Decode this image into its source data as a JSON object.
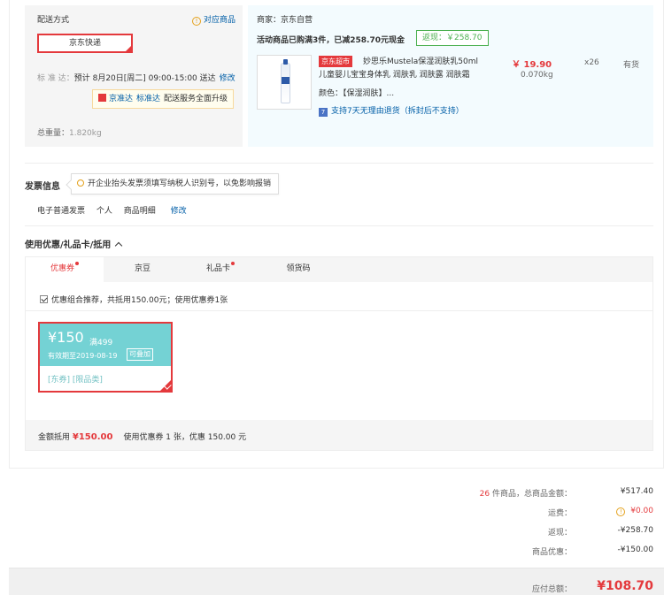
{
  "shipping": {
    "title": "配送方式",
    "link": "对应商品",
    "option": "京东快递",
    "time_label": "标 准 达：",
    "time_value": "预计 8月20日[周二] 09:00-15:00 送达",
    "edit": "修改",
    "tip_items": [
      "京准达",
      "标准达"
    ],
    "tip_text": "配送服务全面升级",
    "weight_label": "总重量：",
    "weight_value": "1.820kg"
  },
  "merchant": {
    "name": "商家：京东自营",
    "promo": "活动商品已购满3件，已减258.70元现金",
    "rebate": "返现：￥258.70",
    "product": {
      "tag": "京东超市",
      "name": "妙思乐Mustela保湿润肤乳50ml 儿童婴儿宝宝身体乳 润肤乳 润肤露 润肤霜",
      "color": "颜色：【保湿润肤】...",
      "return_icon": "7",
      "return_policy": "支持7天无理由退货（拆封后不支持）",
      "price": "￥ 19.90",
      "weight": "0.070kg",
      "qty": "x26",
      "stock": "有货"
    }
  },
  "invoice": {
    "title": "发票信息",
    "tip": "开企业抬头发票须填写纳税人识别号，以免影响报销",
    "type": "电子普通发票",
    "holder": "个人",
    "content": "商品明细",
    "edit": "修改"
  },
  "coupons": {
    "title": "使用优惠/礼品卡/抵用",
    "tabs": [
      {
        "label": "优惠券",
        "dot": true
      },
      {
        "label": "京豆",
        "dot": false
      },
      {
        "label": "礼品卡",
        "dot": true
      },
      {
        "label": "领货码",
        "dot": false
      }
    ],
    "recommend": "优惠组合推荐，共抵用150.00元；使用优惠券1张",
    "coupon": {
      "amount": "¥150",
      "min": "满499",
      "expiry": "有效期至2019-08-19",
      "stack": "可叠加",
      "tags": "[东券]  [限品类]"
    },
    "total_label": "金额抵用",
    "total_amount": "¥150.00",
    "total_desc": "使用优惠券 1 张，优惠 150.00 元"
  },
  "summary": {
    "count": "26",
    "count_label": " 件商品，总商品金额：",
    "goods_total": "¥517.40",
    "freight_label": "运费：",
    "freight": "¥0.00",
    "rebate_label": "返现：",
    "rebate": "-¥258.70",
    "discount_label": "商品优惠：",
    "discount": "-¥150.00",
    "pay_label": "应付总额：",
    "pay_total": "¥108.70"
  },
  "colors": {
    "accent": "#e4393c",
    "link": "#005ea7",
    "rebate": "#4cb050",
    "coupon": "#74d2d4"
  }
}
